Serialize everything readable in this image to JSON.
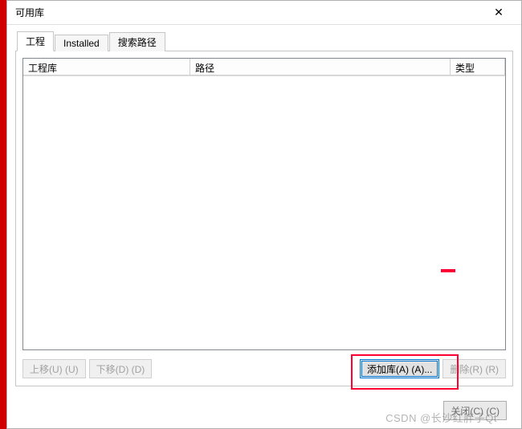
{
  "window": {
    "title": "可用库",
    "close_icon": "✕"
  },
  "tabs": {
    "project": "工程",
    "installed": "Installed",
    "search_path": "搜索路径"
  },
  "columns": {
    "library": "工程库",
    "path": "路径",
    "type": "类型"
  },
  "buttons": {
    "move_up": "上移(U) (U)",
    "move_down": "下移(D) (D)",
    "add_lib": "添加库(A) (A)...",
    "delete": "删除(R) (R)",
    "close": "关闭(C) (C)"
  },
  "watermark": "CSDN @长沙红胖子Qt"
}
